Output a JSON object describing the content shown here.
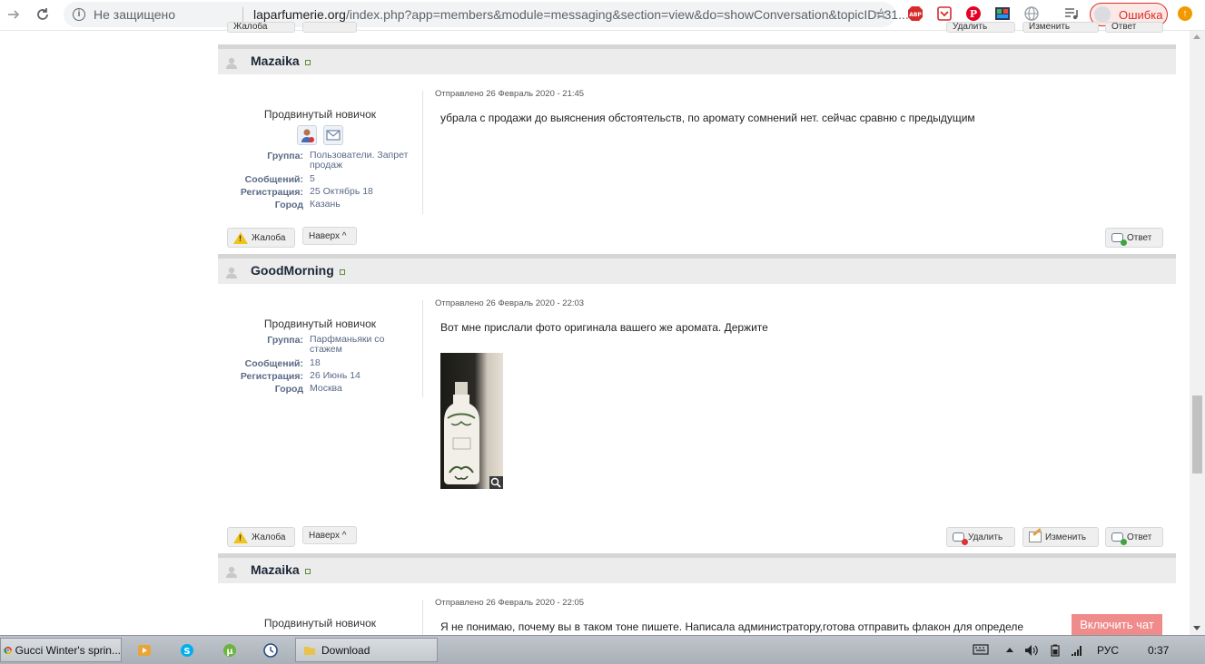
{
  "browser": {
    "security_label": "Не защищено",
    "url_host": "laparfumerie.org",
    "url_rest": "/index.php?app=members&module=messaging&section=view&do=showConversation&topicID=31...",
    "profile_status": "Ошибка",
    "extensions": [
      "adblock-icon",
      "pocket-icon",
      "pinterest-icon",
      "screen-capture-icon",
      "globe-icon",
      "playlist-icon"
    ]
  },
  "top_partial": {
    "report_label": "Жалоба",
    "delete_label": "Удалить",
    "edit_label": "Изменить",
    "reply_label": "Ответ"
  },
  "posts": [
    {
      "author": "Mazaika",
      "rank": "Продвинутый новичок",
      "fields": [
        {
          "k": "Группа:",
          "v": "Пользователи. Запрет продаж"
        },
        {
          "k": "Сообщений:",
          "v": "5"
        },
        {
          "k": "Регистрация:",
          "v": "25 Октябрь 18"
        },
        {
          "k": "Город",
          "v": "Казань"
        }
      ],
      "posted": "Отправлено 26 Февраль 2020 - 21:45",
      "body": "убрала с продажи до выяснения обстоятельств, по аромату сомнений нет. сейчас сравню с предыдущим",
      "actions": {
        "report": "Жалоба",
        "top": "Наверх ^",
        "reply": "Ответ"
      }
    },
    {
      "author": "GoodMorning",
      "rank": "Продвинутый новичок",
      "fields": [
        {
          "k": "Группа:",
          "v": "Парфманьяки со стажем"
        },
        {
          "k": "Сообщений:",
          "v": "18"
        },
        {
          "k": "Регистрация:",
          "v": "26 Июнь 14"
        },
        {
          "k": "Город",
          "v": "Москва"
        }
      ],
      "posted": "Отправлено 26 Февраль 2020 - 22:03",
      "body": "Вот мне прислали фото оригинала вашего же аромата. Держите",
      "actions": {
        "report": "Жалоба",
        "top": "Наверх ^",
        "delete": "Удалить",
        "edit": "Изменить",
        "reply": "Ответ"
      }
    },
    {
      "author": "Mazaika",
      "rank": "Продвинутый новичок",
      "posted": "Отправлено 26 Февраль 2020 - 22:05",
      "body": "Я не понимаю, почему вы в таком тоне пишете. Написала администратору,готова отправить флакон для определе"
    }
  ],
  "chat_button": "Включить чат",
  "taskbar": {
    "tasks": [
      {
        "label": "Gucci Winter's sprin...",
        "active": true
      },
      {
        "label": "Download",
        "active": true
      }
    ],
    "language": "РУС",
    "clock": "0:37"
  },
  "colors": {
    "accent_name": "#1c2837",
    "meta_text": "#5a6a86",
    "chat_button": "#f08b8b",
    "error_red": "#d93025"
  }
}
